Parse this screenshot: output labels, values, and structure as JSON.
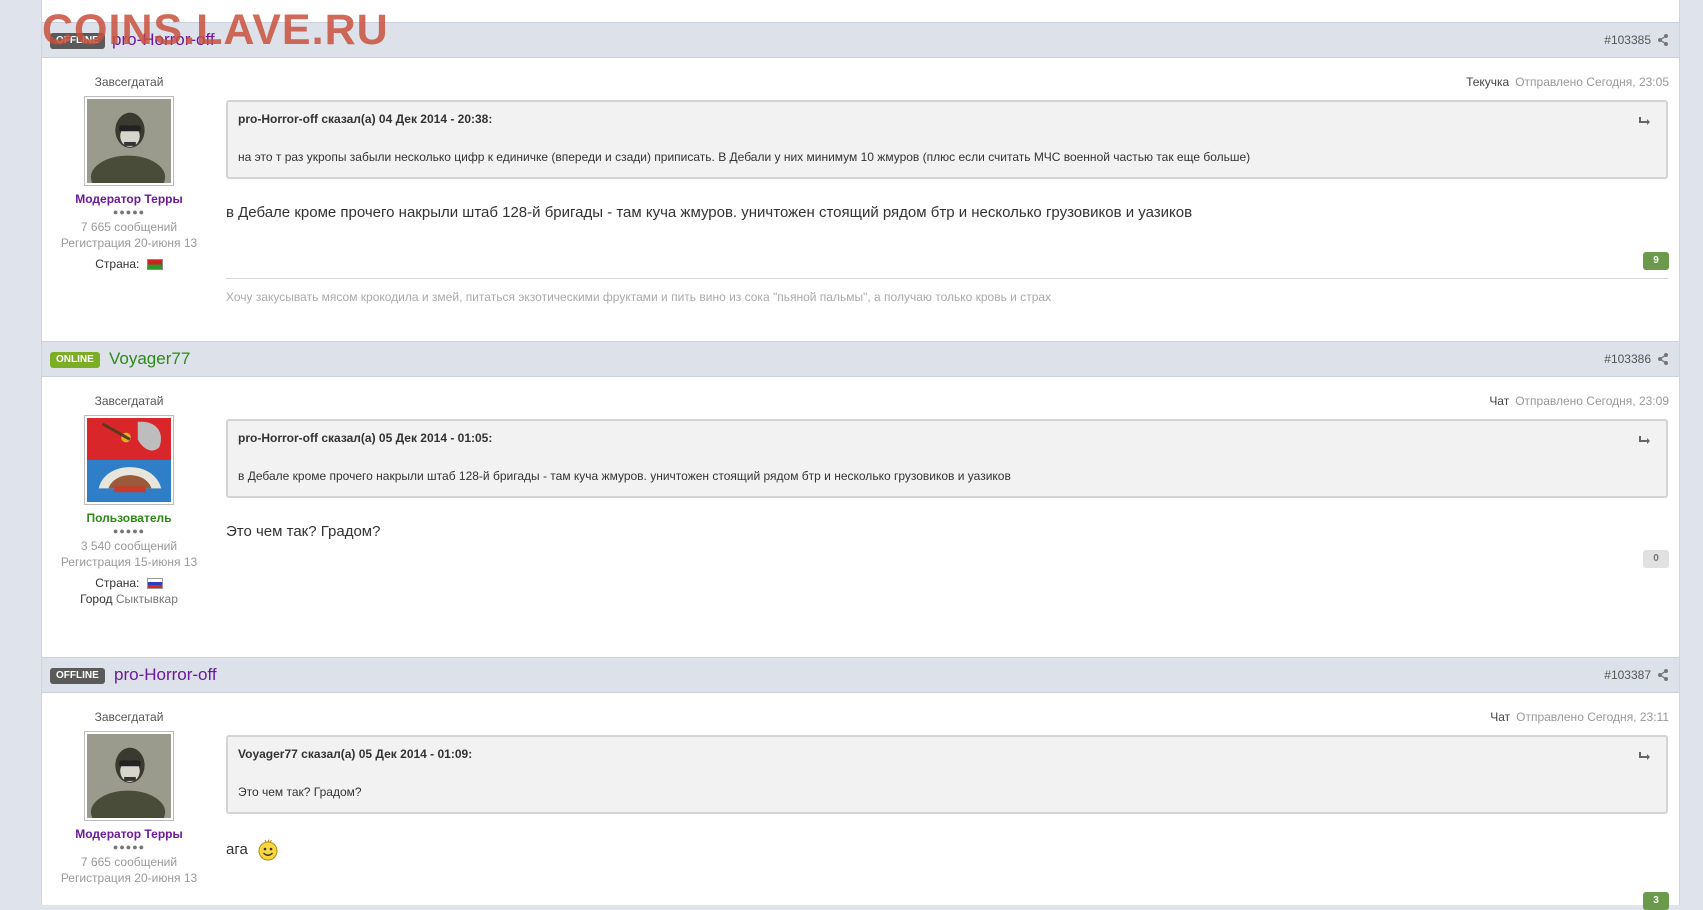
{
  "watermark": "COINS.LAVE.RU",
  "posts": [
    {
      "status": "OFFLINE",
      "author": "pro-Horror-off",
      "number": "#103385",
      "rank": "Завсегдатай",
      "group": "Модератор Терры",
      "pips": "●●●●●",
      "messages": "7 665 сообщений",
      "registered": "Регистрация 20-июня 13",
      "country_label": "Страна:",
      "meta_label": "Текучка",
      "posted": "Отправлено Сегодня, 23:05",
      "quote_citation": "pro-Horror-off сказал(а) 04 Дек 2014 - 20:38:",
      "quote_text": "на это т раз укропы забыли несколько цифр к единичке (впереди и сзади) приписать. В Дебали у них минимум 10 жмуров (плюс если считать МЧС военной частью так еще больше)",
      "body": "в Дебале кроме прочего накрыли штаб 128-й бригады - там куча жмуров. уничтожен стоящий рядом бтр и несколько грузовиков и уазиков",
      "reputation": "9",
      "signature": "Хочу закусывать мясом крокодила и змей, питаться экзотическими фруктами и пить вино из сока \"пьяной пальмы\", а получаю только кровь и страх"
    },
    {
      "status": "ONLINE",
      "author": "Voyager77",
      "number": "#103386",
      "rank": "Завсегдатай",
      "group": "Пользователь",
      "pips": "●●●●●",
      "messages": "3 540 сообщений",
      "registered": "Регистрация 15-июня 13",
      "country_label": "Страна:",
      "city_label": "Город",
      "city": "Сыктывкар",
      "meta_label": "Чат",
      "posted": "Отправлено Сегодня, 23:09",
      "quote_citation": "pro-Horror-off сказал(а) 05 Дек 2014 - 01:05:",
      "quote_text": "в Дебале кроме прочего накрыли штаб 128-й бригады - там куча жмуров. уничтожен стоящий рядом бтр и несколько грузовиков и уазиков",
      "body": "Это чем так? Градом?",
      "reputation": "0"
    },
    {
      "status": "OFFLINE",
      "author": "pro-Horror-off",
      "number": "#103387",
      "rank": "Завсегдатай",
      "group": "Модератор Терры",
      "pips": "●●●●●",
      "messages": "7 665 сообщений",
      "registered": "Регистрация 20-июня 13",
      "meta_label": "Чат",
      "posted": "Отправлено Сегодня, 23:11",
      "quote_citation": "Voyager77 сказал(а) 05 Дек 2014 - 01:09:",
      "quote_text": "Это чем так? Градом?",
      "body": "ага",
      "reputation": "3"
    }
  ],
  "colors": {
    "header_bg": "#dde1ea",
    "online": "#7bae24",
    "offline": "#5a5a5a",
    "moderator": "#6a1a9a",
    "user": "#2d8a18",
    "rep_positive": "#6b9a4c"
  }
}
